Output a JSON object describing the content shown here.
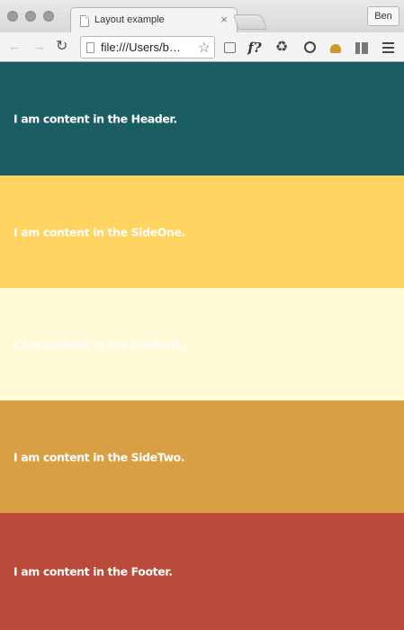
{
  "browser": {
    "tab_title": "Layout example",
    "tab_close": "×",
    "profile_name": "Ben",
    "url": "file:///Users/b…",
    "nav": {
      "back": "←",
      "forward": "→",
      "reload": "↻"
    },
    "bookmark_icon": "star-icon",
    "star_glyph": "☆",
    "extensions": {
      "e2_glyph": "f?",
      "e3_glyph": "♻"
    }
  },
  "page": {
    "sections": [
      {
        "name": "Header",
        "text": "I am content in the Header.",
        "color": "#1a5e63"
      },
      {
        "name": "SideOne",
        "text": "I am content in the SideOne.",
        "color": "#ffd460"
      },
      {
        "name": "Content",
        "text": "I am content in the Content.",
        "color": "#fffad8"
      },
      {
        "name": "SideTwo",
        "text": "I am content in the SideTwo.",
        "color": "#d99f45"
      },
      {
        "name": "Footer",
        "text": "I am content in the Footer.",
        "color": "#b94a39"
      }
    ]
  }
}
